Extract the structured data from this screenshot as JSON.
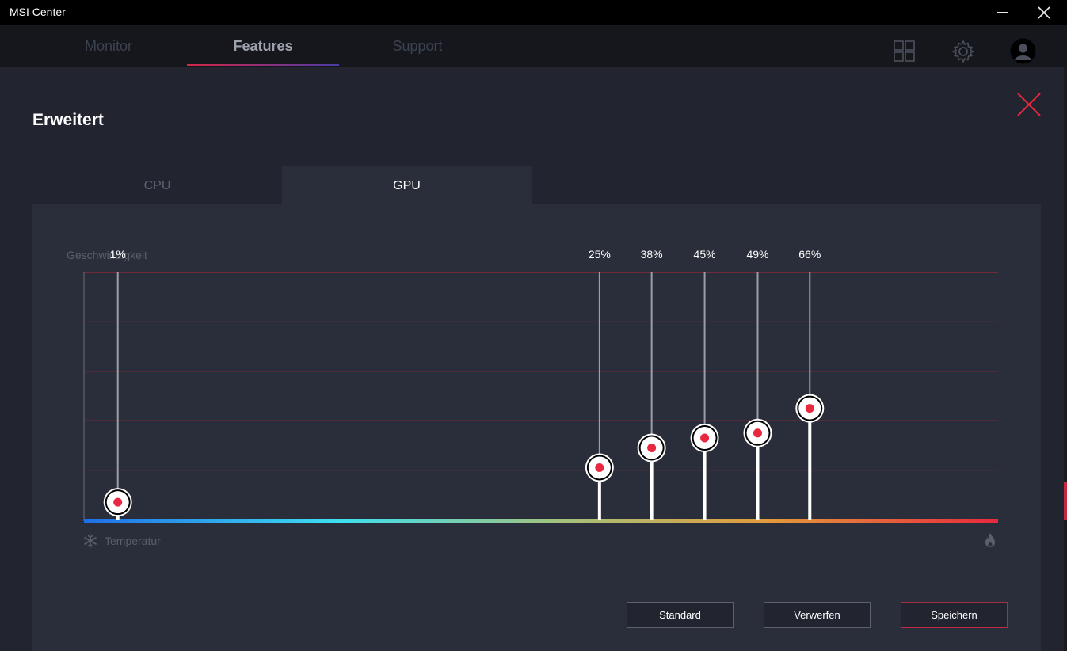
{
  "titlebar": {
    "title": "MSI Center"
  },
  "nav": {
    "tabs": [
      {
        "label": "Monitor",
        "active": false
      },
      {
        "label": "Features",
        "active": true
      },
      {
        "label": "Support",
        "active": false
      }
    ],
    "icons": [
      "grid-icon",
      "gear-icon",
      "user-avatar-icon"
    ]
  },
  "page": {
    "title": "Erweitert"
  },
  "subtabs": [
    {
      "label": "CPU",
      "active": false
    },
    {
      "label": "GPU",
      "active": true
    }
  ],
  "chart_data": {
    "type": "scatter",
    "ylabel": "Geschwindigkeit",
    "xlabel": "Temperatur",
    "ylim": [
      0,
      100
    ],
    "gridlines_y": [
      20,
      40,
      60,
      80,
      100
    ],
    "points": [
      {
        "label": "1%",
        "x": 0.037,
        "y": 7
      },
      {
        "label": "25%",
        "x": 0.564,
        "y": 21
      },
      {
        "label": "38%",
        "x": 0.621,
        "y": 29
      },
      {
        "label": "45%",
        "x": 0.679,
        "y": 33
      },
      {
        "label": "49%",
        "x": 0.737,
        "y": 35
      },
      {
        "label": "66%",
        "x": 0.794,
        "y": 45
      }
    ],
    "colors": {
      "gridline": "#b5283a",
      "point_dot": "#e8283e",
      "gradient": [
        "#1f6fe8",
        "#3ee0f0",
        "#a3c27d",
        "#e39a3a",
        "#e8283e"
      ]
    }
  },
  "buttons": {
    "standard": "Standard",
    "discard": "Verwerfen",
    "save": "Speichern"
  },
  "colors": {
    "background": "#22252f",
    "panel": "#2a2e3a",
    "accent": "#e8283e"
  }
}
